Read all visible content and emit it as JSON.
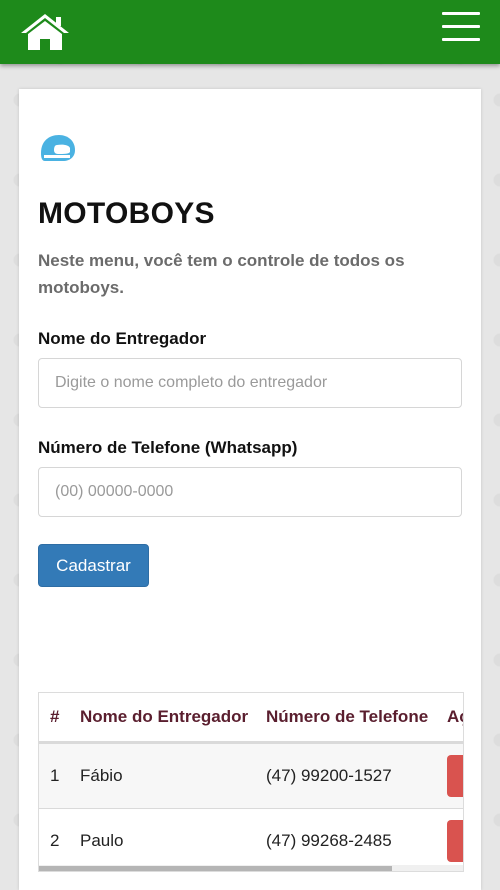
{
  "header": {
    "home_icon": "home-icon",
    "menu_icon": "hamburger-menu-icon",
    "background_color": "#1e8a1b"
  },
  "page": {
    "logo_icon": "helmet-icon",
    "title": "MOTOBOYS",
    "subtitle": "Neste menu, você tem o controle de todos os motoboys."
  },
  "form": {
    "name_label": "Nome do Entregador",
    "name_placeholder": "Digite o nome completo do entregador",
    "name_value": "",
    "phone_label": "Número de Telefone (Whatsapp)",
    "phone_placeholder": "(00) 00000-0000",
    "phone_value": "",
    "submit_label": "Cadastrar"
  },
  "table": {
    "headers": [
      "#",
      "Nome do Entregador",
      "Número de Telefone",
      "Ações"
    ],
    "rows": [
      {
        "id": "1",
        "name": "Fábio",
        "phone": "(47) 99200-1527"
      },
      {
        "id": "2",
        "name": "Paulo",
        "phone": "(47) 99268-2485"
      }
    ]
  },
  "colors": {
    "accent": "#337ab7",
    "danger": "#d9534f",
    "header_text": "#5a1e2e"
  }
}
